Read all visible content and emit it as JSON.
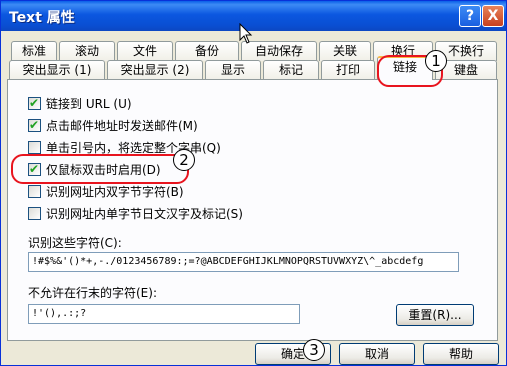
{
  "window": {
    "title": "Text 属性",
    "help_glyph": "?",
    "close_glyph": "X"
  },
  "tabs_row1": [
    "标准",
    "滚动",
    "文件",
    "备份",
    "自动保存",
    "关联",
    "换行",
    "不换行"
  ],
  "tabs_row2": [
    "突出显示 (1)",
    "突出显示 (2)",
    "显示",
    "标记",
    "打印",
    "链接",
    "键盘"
  ],
  "active_tab": "链接",
  "options": [
    {
      "label": "链接到 URL (U)",
      "checked": true
    },
    {
      "label": "点击邮件地址时发送邮件(M)",
      "checked": true
    },
    {
      "label": "单击引号内，将选定整个字串(Q)",
      "checked": false
    },
    {
      "label": "仅鼠标双击时启用(D)",
      "checked": true
    },
    {
      "label": "识别网址内双字节字符(B)",
      "checked": false
    },
    {
      "label": "识别网址内单字节日文汉字及标记(S)",
      "checked": false
    }
  ],
  "chars_label": "识别这些字符(C):",
  "chars_value": "!#$%&'()*+,-./0123456789:;=?@ABCDEFGHIJKLMNOPQRSTUVWXYZ\\^_abcdefg",
  "no_end_label": "不允许在行末的字符(E):",
  "no_end_value": "!'(),.:;?",
  "reset_button": "重置(R)...",
  "buttons": {
    "ok": "确定",
    "cancel": "取消",
    "help": "帮助"
  },
  "markers": [
    "1",
    "2",
    "3"
  ],
  "colors": {
    "accent_ring": "#e8141e",
    "title_bar": "#0b57e0"
  }
}
